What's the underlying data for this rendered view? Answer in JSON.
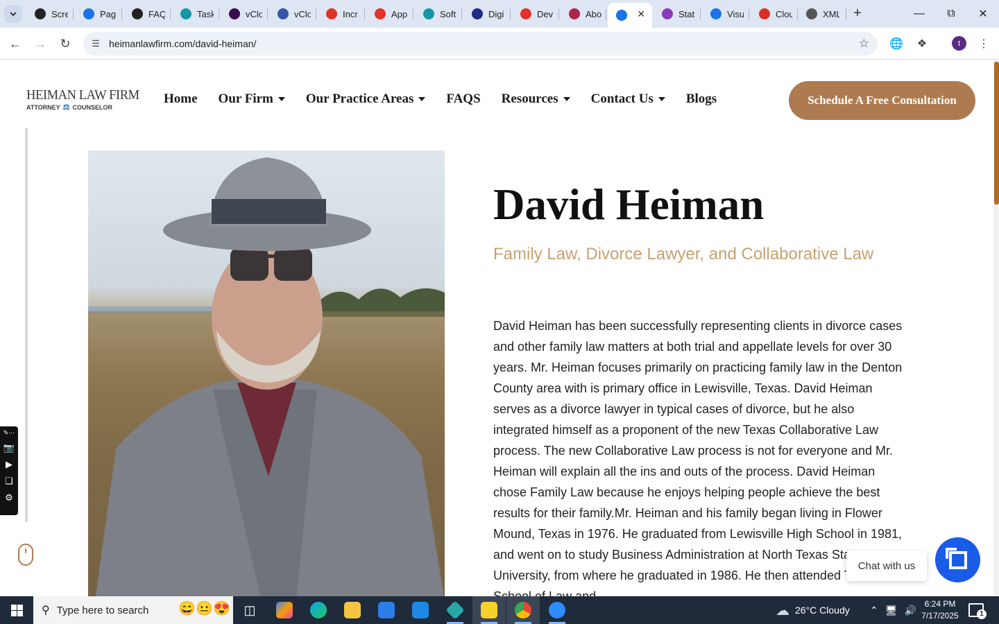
{
  "browser": {
    "tabs": [
      {
        "title": "Scre",
        "icon": "screencast-icon",
        "color": "#222222"
      },
      {
        "title": "Pag",
        "icon": "pagespeed-icon",
        "color": "#1a73e8"
      },
      {
        "title": "FAQ",
        "icon": "faq-icon",
        "color": "#222222"
      },
      {
        "title": "Task",
        "icon": "task-icon",
        "color": "#1496a8"
      },
      {
        "title": "vClo",
        "icon": "vcloud-icon",
        "color": "#3d0a52"
      },
      {
        "title": "vClo",
        "icon": "vcloud-check-icon",
        "color": "#3555a6"
      },
      {
        "title": "Incr",
        "icon": "incr-icon",
        "color": "#e0312b"
      },
      {
        "title": "App",
        "icon": "app-icon",
        "color": "#e0312b"
      },
      {
        "title": "Soft",
        "icon": "soft-icon",
        "color": "#1496a8"
      },
      {
        "title": "Digi",
        "icon": "digi-icon",
        "color": "#1b2b8a"
      },
      {
        "title": "Dev",
        "icon": "dev-icon",
        "color": "#e0312b"
      },
      {
        "title": "Abo",
        "icon": "about-icon",
        "color": "#b0254a"
      },
      {
        "title": "",
        "icon": "scales-of-justice-icon",
        "color": "#1a73e8"
      },
      {
        "title": "Stat",
        "icon": "stat-icon",
        "color": "#8a3ab9"
      },
      {
        "title": "Visu",
        "icon": "visual-icon",
        "color": "#1a73e8"
      },
      {
        "title": "Clou",
        "icon": "cloud-icon",
        "color": "#d93025"
      },
      {
        "title": "XML",
        "icon": "globe-icon",
        "color": "#555555"
      }
    ],
    "url": "heimanlawfirm.com/david-heiman/",
    "profile_initial": "t"
  },
  "site": {
    "logo": {
      "top": "HEIMAN LAW FIRM",
      "left": "ATTORNEY",
      "right": "COUNSELOR"
    },
    "nav": [
      {
        "label": "Home",
        "dropdown": false
      },
      {
        "label": "Our Firm",
        "dropdown": true
      },
      {
        "label": "Our Practice Areas",
        "dropdown": true
      },
      {
        "label": "FAQS",
        "dropdown": false
      },
      {
        "label": "Resources",
        "dropdown": true
      },
      {
        "label": "Contact Us",
        "dropdown": true
      },
      {
        "label": "Blogs",
        "dropdown": false
      }
    ],
    "cta_label": "Schedule A Free Consultation",
    "name": "David Heiman",
    "subtitle": "Family Law, Divorce Lawyer, and Collaborative Law",
    "bio": "David Heiman has been successfully representing clients in divorce cases and other family law matters at both trial and appellate levels for over 30 years. Mr. Heiman focuses primarily on practicing family law in the Denton County area with is primary office in Lewisville, Texas. David Heiman serves as a divorce lawyer in typical cases of divorce, but he also integrated himself as a proponent of the new Texas Collaborative Law process. The new Collaborative Law process is not for everyone and Mr. Heiman will explain all the ins and outs of the process. David Heiman chose Family Law because he enjoys helping people achieve the best results for their family.Mr. Heiman and his family began living in Flower Mound, Texas in 1976. He graduated from Lewisville High School in 1981, and went on to study Business Administration at North Texas State University, from where he graduated in 1986. He then attended Texas Tech School of Law and",
    "chat_label": "Chat with us",
    "colors": {
      "accent": "#ae7b50",
      "subtitle": "#c8a070",
      "chat": "#1a5ce6"
    }
  },
  "taskbar": {
    "search_placeholder": "Type here to search",
    "weather": "26°C  Cloudy",
    "time": "6:24 PM",
    "date": "7/17/2025",
    "notification_count": "1"
  }
}
